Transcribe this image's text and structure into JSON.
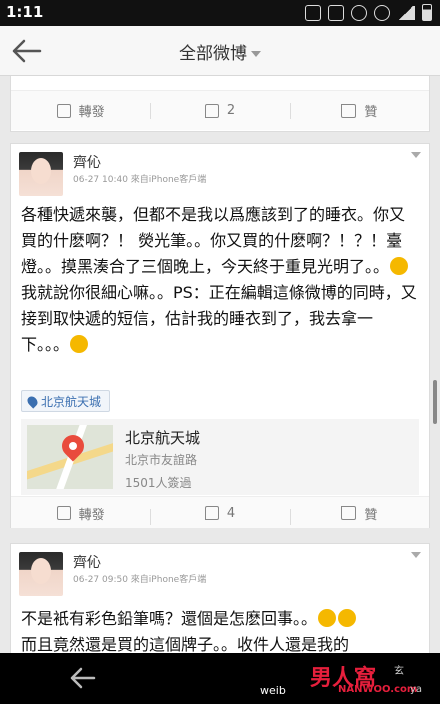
{
  "status_bar": {
    "time": "1:11"
  },
  "header": {
    "title": "全部微博"
  },
  "prev_post": {
    "actions": {
      "repost_label": "轉發",
      "comment_count": "2",
      "like_label": "贊"
    }
  },
  "post1": {
    "username": "齊伈",
    "meta": "06-27 10:40   來自iPhone客戶端",
    "text": "各種快遞來襲，但都不是我以爲應該到了的睡衣。你又買的什麽啊？！ 熒光筆。。你又買的什麽啊？！？！臺燈。。摸黑湊合了三個晚上，今天終于重見光明了。。",
    "text2": "我就說你很細心嘛。。PS：正在編輯這條微博的同時，又接到取快遞的短信，估計我的睡衣到了，我去拿一下。。。",
    "location_tag": "北京航天城",
    "location_card": {
      "name": "北京航天城",
      "address": "北京市友誼路",
      "visits": "1501人簽過"
    },
    "actions": {
      "repost_label": "轉發",
      "comment_count": "4",
      "like_label": "贊"
    }
  },
  "post2": {
    "username": "齊伈",
    "meta": "06-27 09:50   來自iPhone客戶端",
    "text": "不是衹有彩色鉛筆嗎？還個是怎麽回事。。",
    "text2": "而且竟然還是買的這個牌子。。收件人還是我的"
  },
  "watermark": {
    "logo": "男人窩",
    "url": "NANWOO.com",
    "prefix": "weib",
    "suffix": "ya",
    "handle": "玄"
  },
  "colors": {
    "accent": "#3b6fb0",
    "marker": "#e94b3c",
    "brand_red": "#e61f3c"
  }
}
